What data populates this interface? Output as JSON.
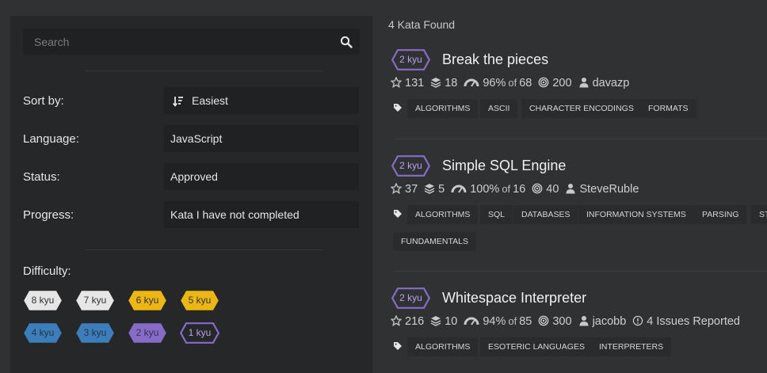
{
  "search": {
    "placeholder": "Search"
  },
  "filters": {
    "sort_by": {
      "label": "Sort by:",
      "value": "Easiest"
    },
    "language": {
      "label": "Language:",
      "value": "JavaScript"
    },
    "status": {
      "label": "Status:",
      "value": "Approved"
    },
    "progress": {
      "label": "Progress:",
      "value": "Kata I have not completed"
    }
  },
  "difficulty": {
    "label": "Difficulty:",
    "levels": [
      {
        "label": "8 kyu",
        "color": "#e6e6e6",
        "text_color": "#333333",
        "style": "filled"
      },
      {
        "label": "7 kyu",
        "color": "#e6e6e6",
        "text_color": "#333333",
        "style": "filled"
      },
      {
        "label": "6 kyu",
        "color": "#ecb613",
        "text_color": "#333333",
        "style": "filled"
      },
      {
        "label": "5 kyu",
        "color": "#ecb613",
        "text_color": "#333333",
        "style": "filled"
      },
      {
        "label": "4 kyu",
        "color": "#3c7ebb",
        "text_color": "#263443",
        "style": "filled"
      },
      {
        "label": "3 kyu",
        "color": "#3c7ebb",
        "text_color": "#263443",
        "style": "filled"
      },
      {
        "label": "2 kyu",
        "color": "#866cc7",
        "text_color": "#3b2f5c",
        "style": "filled"
      },
      {
        "label": "1 kyu",
        "color": "#866cc7",
        "text_color": "#b9a4ec",
        "style": "outline"
      }
    ]
  },
  "results": {
    "count_text": "4 Kata Found",
    "katas": [
      {
        "rank": "2 kyu",
        "title": "Break the pieces",
        "stars": "131",
        "collections": "18",
        "satisfaction": "96%",
        "of_label": "of",
        "votes": "68",
        "completions": "200",
        "author": "davazp",
        "issues": "",
        "tag_rows": [
          [
            "ALGORITHMS",
            "ASCII",
            "CHARACTER ENCODINGS",
            "FORMATS"
          ]
        ]
      },
      {
        "rank": "2 kyu",
        "title": "Simple SQL Engine",
        "stars": "37",
        "collections": "5",
        "satisfaction": "100%",
        "of_label": "of",
        "votes": "16",
        "completions": "40",
        "author": "SteveRuble",
        "issues": "",
        "tag_rows": [
          [
            "ALGORITHMS",
            "SQL",
            "DATABASES",
            "INFORMATION SYSTEMS",
            "PARSING",
            "STRI"
          ],
          [
            "FUNDAMENTALS"
          ]
        ]
      },
      {
        "rank": "2 kyu",
        "title": "Whitespace Interpreter",
        "stars": "216",
        "collections": "10",
        "satisfaction": "94%",
        "of_label": "of",
        "votes": "85",
        "completions": "300",
        "author": "jacobb",
        "issues": "4 Issues Reported",
        "tag_rows": [
          [
            "ALGORITHMS",
            "ESOTERIC LANGUAGES",
            "INTERPRETERS"
          ]
        ]
      }
    ]
  },
  "colors": {
    "accent": "#866cc7",
    "background": "#303133",
    "panel": "#262729",
    "field": "#202123"
  },
  "icons": [
    "search-icon",
    "sort-icon",
    "star-icon",
    "collection-icon",
    "gauge-icon",
    "completions-icon",
    "author-icon",
    "issue-icon",
    "tag-icon"
  ]
}
